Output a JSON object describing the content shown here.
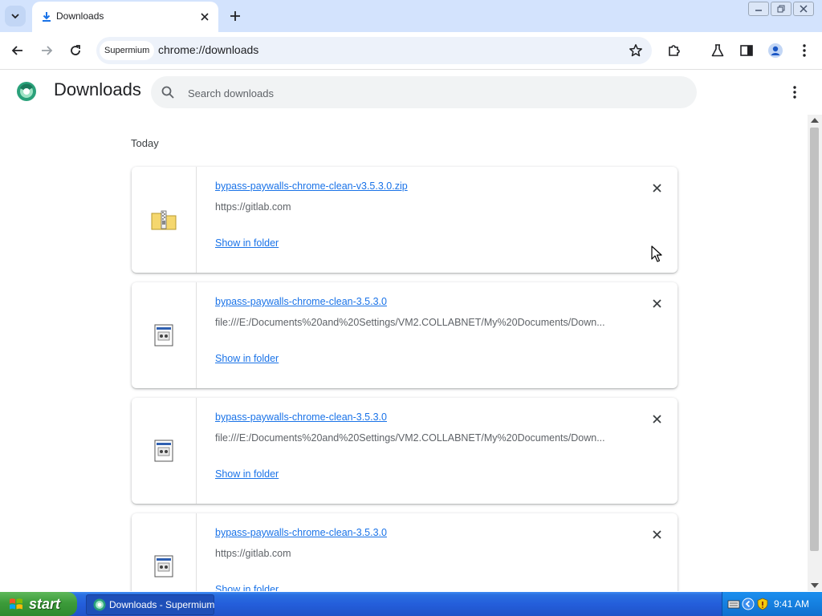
{
  "browser": {
    "tab_title": "Downloads",
    "profile_chip": "Supermium",
    "url": "chrome://downloads"
  },
  "page": {
    "title": "Downloads",
    "search_placeholder": "Search downloads",
    "section_label": "Today"
  },
  "downloads": [
    {
      "file_name": "bypass-paywalls-chrome-clean-v3.5.3.0.zip",
      "source": "https://gitlab.com",
      "action": "Show in folder",
      "icon": "zip-folder-icon"
    },
    {
      "file_name": "bypass-paywalls-chrome-clean-3.5.3.0",
      "source": "file:///E:/Documents%20and%20Settings/VM2.COLLABNET/My%20Documents/Down...",
      "action": "Show in folder",
      "icon": "generic-file-icon"
    },
    {
      "file_name": "bypass-paywalls-chrome-clean-3.5.3.0",
      "source": "file:///E:/Documents%20and%20Settings/VM2.COLLABNET/My%20Documents/Down...",
      "action": "Show in folder",
      "icon": "generic-file-icon"
    },
    {
      "file_name": "bypass-paywalls-chrome-clean-3.5.3.0",
      "source": "https://gitlab.com",
      "action": "Show in folder",
      "icon": "generic-file-icon"
    }
  ],
  "taskbar": {
    "start_label": "start",
    "task_label": "Downloads - Supermium",
    "clock": "9:41 AM"
  },
  "colors": {
    "tabstrip": "#d3e3fd",
    "link": "#1a73e8",
    "taskbar": "#245edb",
    "start_button": "#3c9b3a"
  }
}
